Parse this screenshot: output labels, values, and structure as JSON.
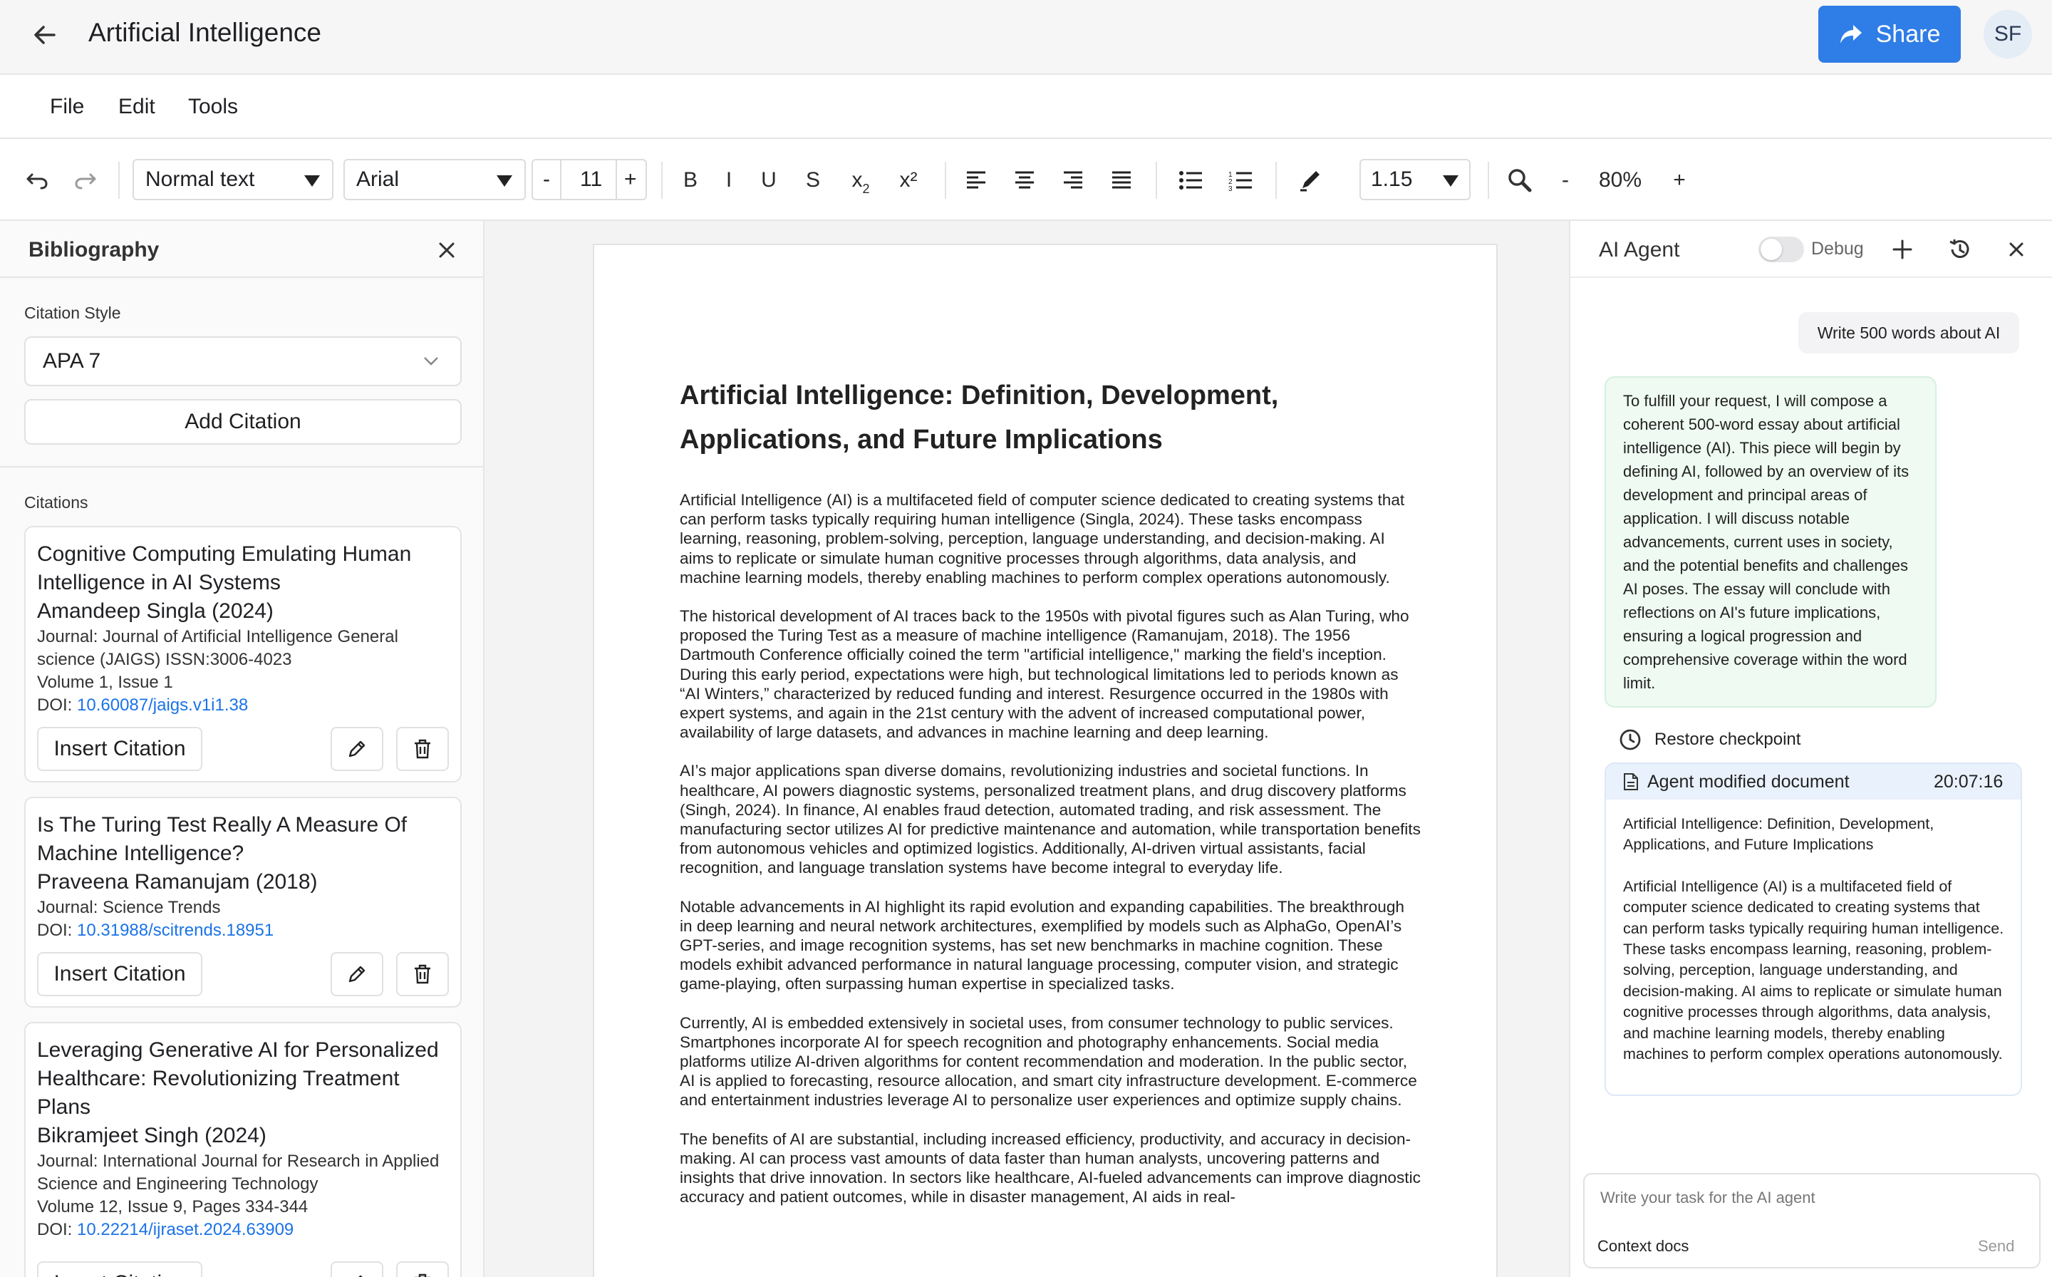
{
  "header": {
    "title": "Artificial Intelligence",
    "share_label": "Share",
    "avatar_initials": "SF",
    "share_color": "#2f7de6"
  },
  "menu": [
    "File",
    "Edit",
    "Tools"
  ],
  "toolbar": {
    "paragraph_style": "Normal text",
    "font": "Arial",
    "font_size_minus": "-",
    "font_size": "11",
    "font_size_plus": "+",
    "bold": "B",
    "italic": "I",
    "underline": "U",
    "strike": "S",
    "subscript": "x",
    "subscript_mark": "2",
    "superscript": "x²",
    "line_spacing": "1.15",
    "zoom_minus": "-",
    "zoom": "80%",
    "zoom_plus": "+"
  },
  "bibliography": {
    "title": "Bibliography",
    "style_label": "Citation Style",
    "style_value": "APA 7",
    "add_citation": "Add Citation",
    "citations_label": "Citations",
    "insert_label": "Insert Citation",
    "citations": [
      {
        "title": "Cognitive Computing Emulating Human Intelligence in AI Systems",
        "author": "Amandeep Singla (2024)",
        "journal": "Journal: Journal of Artificial Intelligence General science (JAIGS) ISSN:3006-4023",
        "volume": "Volume 1, Issue 1",
        "doi_label": "DOI:",
        "doi": "10.60087/jaigs.v1i1.38"
      },
      {
        "title": "Is The Turing Test Really A Measure Of Machine Intelligence?",
        "author": "Praveena Ramanujam (2018)",
        "journal": "Journal: Science Trends",
        "volume": "",
        "doi_label": "DOI:",
        "doi": "10.31988/scitrends.18951"
      },
      {
        "title": "Leveraging Generative AI for Personalized Healthcare: Revolutionizing Treatment Plans",
        "author": "Bikramjeet Singh (2024)",
        "journal": "Journal: International Journal for Research in Applied Science and Engineering Technology",
        "volume": "Volume 12, Issue 9, Pages 334-344",
        "doi_label": "DOI:",
        "doi": "10.22214/ijraset.2024.63909"
      }
    ]
  },
  "document": {
    "heading": "Artificial Intelligence: Definition, Development, Applications, and Future Implications",
    "paragraphs": [
      "Artificial Intelligence (AI) is a multifaceted field of computer science dedicated to creating systems that can perform tasks typically requiring human intelligence (Singla, 2024). These tasks encompass learning, reasoning, problem-solving, perception, language understanding, and decision-making. AI aims to replicate or simulate human cognitive processes through algorithms, data analysis, and machine learning models, thereby enabling machines to perform complex operations autonomously.",
      "The historical development of AI traces back to the 1950s with pivotal figures such as Alan Turing, who proposed the Turing Test as a measure of machine intelligence (Ramanujam, 2018). The 1956 Dartmouth Conference officially coined the term \"artificial intelligence,\" marking the field's inception. During this early period, expectations were high, but technological limitations led to periods known as “AI Winters,” characterized by reduced funding and interest. Resurgence occurred in the 1980s with expert systems, and again in the 21st century with the advent of increased computational power, availability of large datasets, and advances in machine learning and deep learning.",
      "AI’s major applications span diverse domains, revolutionizing industries and societal functions. In healthcare, AI powers diagnostic systems, personalized treatment plans, and drug discovery platforms (Singh, 2024). In finance, AI enables fraud detection, automated trading, and risk assessment. The manufacturing sector utilizes AI for predictive maintenance and automation, while transportation benefits from autonomous vehicles and optimized logistics. Additionally, AI-driven virtual assistants, facial recognition, and language translation systems have become integral to everyday life.",
      "Notable advancements in AI highlight its rapid evolution and expanding capabilities. The breakthrough in deep learning and neural network architectures, exemplified by models such as AlphaGo, OpenAI’s GPT-series, and image recognition systems, has set new benchmarks in machine cognition. These models exhibit advanced performance in natural language processing, computer vision, and strategic game-playing, often surpassing human expertise in specialized tasks.",
      "Currently, AI is embedded extensively in societal uses, from consumer technology to public services. Smartphones incorporate AI for speech recognition and photography enhancements. Social media platforms utilize AI-driven algorithms for content recommendation and moderation. In the public sector, AI is applied to forecasting, resource allocation, and smart city infrastructure development. E-commerce and entertainment industries leverage AI to personalize user experiences and optimize supply chains.",
      "The benefits of AI are substantial, including increased efficiency, productivity, and accuracy in decision-making. AI can process vast amounts of data faster than human analysts, uncovering patterns and insights that drive innovation. In sectors like healthcare, AI-fueled advancements can improve diagnostic accuracy and patient outcomes, while in disaster management, AI aids in real-"
    ]
  },
  "agent": {
    "title": "AI Agent",
    "debug_label": "Debug",
    "user_message": "Write 500 words about AI",
    "ai_message": "To fulfill your request, I will compose a coherent 500-word essay about artificial intelligence (AI). This piece will begin by defining AI, followed by an overview of its development and principal areas of application. I will discuss notable advancements, current uses in society, and the potential benefits and challenges AI poses. The essay will conclude with reflections on AI's future implications, ensuring a logical progression and comprehensive coverage within the word limit.",
    "restore_label": "Restore checkpoint",
    "modified_label": "Agent modified document",
    "modified_time": "20:07:16",
    "modified_title": "Artificial Intelligence: Definition, Development, Applications, and Future Implications",
    "modified_body": "Artificial Intelligence (AI) is a multifaceted field of computer science dedicated to creating systems that can perform tasks typically requiring human intelligence. These tasks encompass learning, reasoning, problem-solving, perception, language understanding, and decision-making. AI aims to replicate or simulate human cognitive processes through algorithms, data analysis, and machine learning models, thereby enabling machines to perform complex operations autonomously.",
    "task_placeholder": "Write your task for the AI agent",
    "context_docs_label": "Context docs",
    "send_label": "Send",
    "bubble_color": "#eefaf2",
    "card_header_color": "#e9f1fc"
  }
}
